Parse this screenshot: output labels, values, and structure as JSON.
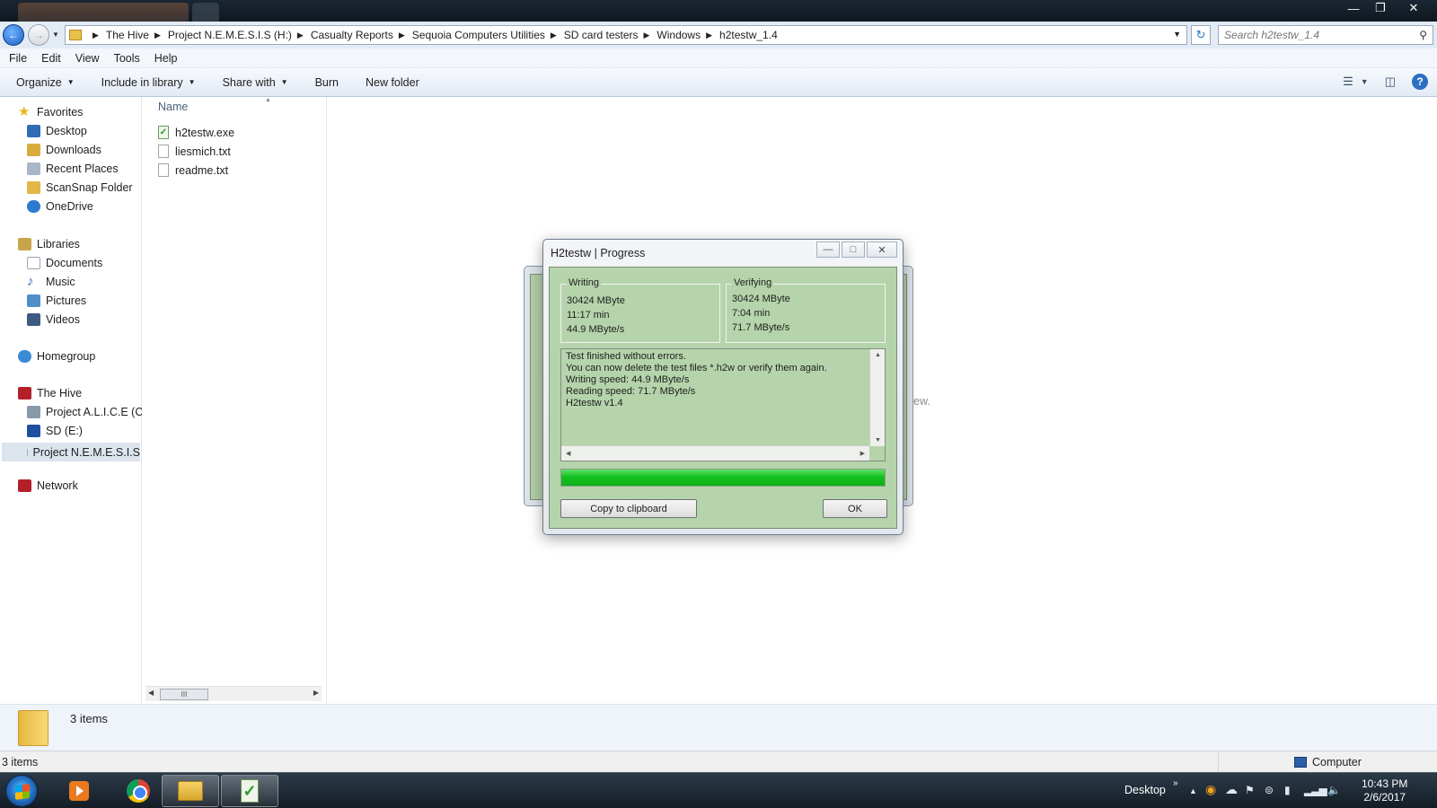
{
  "explorer": {
    "breadcrumb": [
      "The Hive",
      "Project N.E.M.E.S.I.S (H:)",
      "Casualty Reports",
      "Sequoia Computers Utilities",
      "SD card testers",
      "Windows",
      "h2testw_1.4"
    ],
    "search_placeholder": "Search h2testw_1.4",
    "menu": [
      "File",
      "Edit",
      "View",
      "Tools",
      "Help"
    ],
    "commands": {
      "organize": "Organize",
      "include": "Include in library",
      "share": "Share with",
      "burn": "Burn",
      "new_folder": "New folder"
    },
    "nav": {
      "favorites": "Favorites",
      "desktop": "Desktop",
      "downloads": "Downloads",
      "recent": "Recent Places",
      "scansnap": "ScanSnap Folder",
      "onedrive": "OneDrive",
      "libraries": "Libraries",
      "documents": "Documents",
      "music": "Music",
      "pictures": "Pictures",
      "videos": "Videos",
      "homegroup": "Homegroup",
      "hive": "The Hive",
      "alice": "Project A.L.I.C.E (C:)",
      "sd": "SD (E:)",
      "nemesis": "Project N.E.M.E.S.I.S",
      "network": "Network"
    },
    "column_name": "Name",
    "files": [
      "h2testw.exe",
      "liesmich.txt",
      "readme.txt"
    ],
    "scroll_thumb": "III",
    "preview_text": "view.",
    "details_count": "3 items",
    "status_left": "3 items",
    "status_right": "Computer"
  },
  "dialog": {
    "title": "H2testw | Progress",
    "writing": {
      "title": "Writing",
      "size": "30424 MByte",
      "time": "11:17 min",
      "speed": "44.9 MByte/s"
    },
    "verifying": {
      "title": "Verifying",
      "size": "30424 MByte",
      "time": "7:04 min",
      "speed": "71.7 MByte/s"
    },
    "log": [
      "Test finished without errors.",
      "You can now delete the test files *.h2w or verify them again.",
      "Writing speed: 44.9 MByte/s",
      "Reading speed: 71.7 MByte/s",
      "H2testw v1.4"
    ],
    "progress": 1.0,
    "copy_label": "Copy to clipboard",
    "ok_label": "OK"
  },
  "taskbar": {
    "desktop_label": "Desktop",
    "time": "10:43 PM",
    "date": "2/6/2017"
  },
  "colors": {
    "dialog_bg": "#b5d4ab",
    "progress": "#14c11f"
  }
}
